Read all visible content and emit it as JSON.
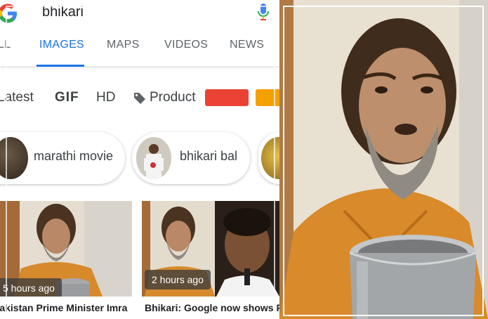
{
  "search": {
    "query": "bhikari"
  },
  "tabs": [
    {
      "label": "ALL"
    },
    {
      "label": "IMAGES"
    },
    {
      "label": "MAPS"
    },
    {
      "label": "VIDEOS"
    },
    {
      "label": "NEWS"
    }
  ],
  "active_tab": "IMAGES",
  "filters": {
    "latest": "Latest",
    "gif": "GIF",
    "hd": "HD",
    "product": "Product",
    "color_swatches": [
      "#ea4335",
      "#f4a000"
    ]
  },
  "chips": [
    {
      "label": "marathi movie"
    },
    {
      "label": "bhikari bal"
    }
  ],
  "results": [
    {
      "time": "5 hours ago",
      "caption": "Pakistan Prime Minister Imra"
    },
    {
      "time": "2 hours ago",
      "caption": "Bhikari: Google now shows P"
    }
  ],
  "colors": {
    "accent": "#1a73e8",
    "shirt": "#d98a2a",
    "wall": "#e8e1d2"
  }
}
